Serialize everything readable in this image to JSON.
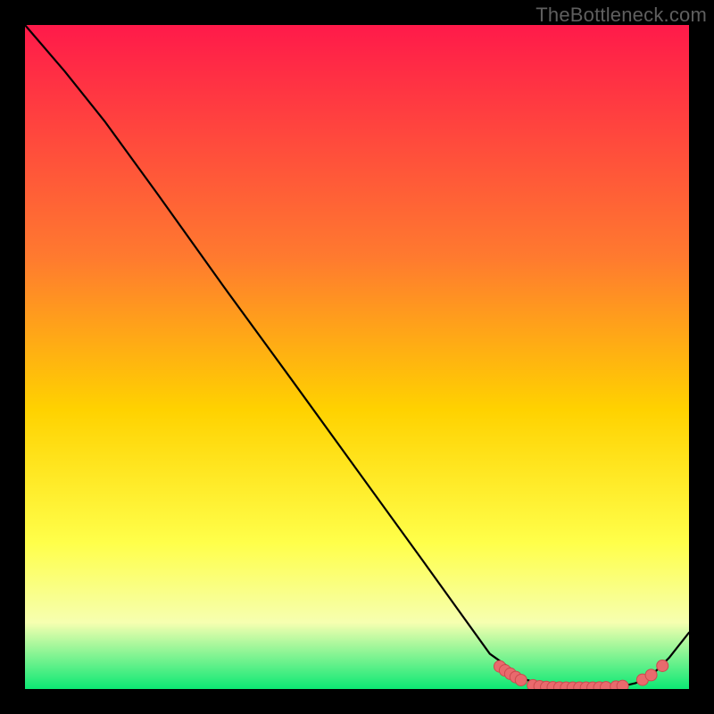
{
  "watermark": "TheBottleneck.com",
  "colors": {
    "black": "#000000",
    "curve": "#000000",
    "marker_fill": "#e96a6d",
    "marker_stroke": "#cc4b4f",
    "grad_top": "#ff1a4a",
    "grad_mid1": "#ff7a2f",
    "grad_mid2": "#ffd200",
    "grad_mid3": "#ffff4a",
    "grad_mid4": "#f6ffb0",
    "grad_bottom": "#0ce874"
  },
  "chart_data": {
    "type": "line",
    "title": "",
    "xlabel": "",
    "ylabel": "",
    "xlim": [
      0,
      100
    ],
    "ylim": [
      0,
      100
    ],
    "series": [
      {
        "name": "curve",
        "x": [
          0,
          6,
          12,
          20,
          30,
          40,
          50,
          60,
          70,
          75.5,
          77,
          79,
          81,
          83,
          85,
          87,
          89,
          90.5,
          92,
          93.5,
          95,
          97,
          100
        ],
        "y": [
          100,
          93,
          85.5,
          74.5,
          60.5,
          46.8,
          33,
          19.2,
          5.3,
          1.4,
          0.9,
          0.5,
          0.35,
          0.28,
          0.25,
          0.27,
          0.35,
          0.55,
          0.9,
          1.6,
          2.7,
          4.7,
          8.5
        ]
      }
    ],
    "markers": [
      {
        "x": 71.5,
        "y": 3.4
      },
      {
        "x": 72.3,
        "y": 2.8
      },
      {
        "x": 73.1,
        "y": 2.3
      },
      {
        "x": 73.9,
        "y": 1.8
      },
      {
        "x": 74.7,
        "y": 1.35
      },
      {
        "x": 76.5,
        "y": 0.55
      },
      {
        "x": 77.5,
        "y": 0.4
      },
      {
        "x": 78.5,
        "y": 0.3
      },
      {
        "x": 79.5,
        "y": 0.25
      },
      {
        "x": 80.5,
        "y": 0.22
      },
      {
        "x": 81.5,
        "y": 0.2
      },
      {
        "x": 82.5,
        "y": 0.2
      },
      {
        "x": 83.5,
        "y": 0.2
      },
      {
        "x": 84.5,
        "y": 0.2
      },
      {
        "x": 85.5,
        "y": 0.2
      },
      {
        "x": 86.5,
        "y": 0.22
      },
      {
        "x": 87.5,
        "y": 0.25
      },
      {
        "x": 89.0,
        "y": 0.35
      },
      {
        "x": 90.0,
        "y": 0.45
      },
      {
        "x": 93.0,
        "y": 1.4
      },
      {
        "x": 94.3,
        "y": 2.1
      },
      {
        "x": 96.0,
        "y": 3.5
      }
    ]
  }
}
